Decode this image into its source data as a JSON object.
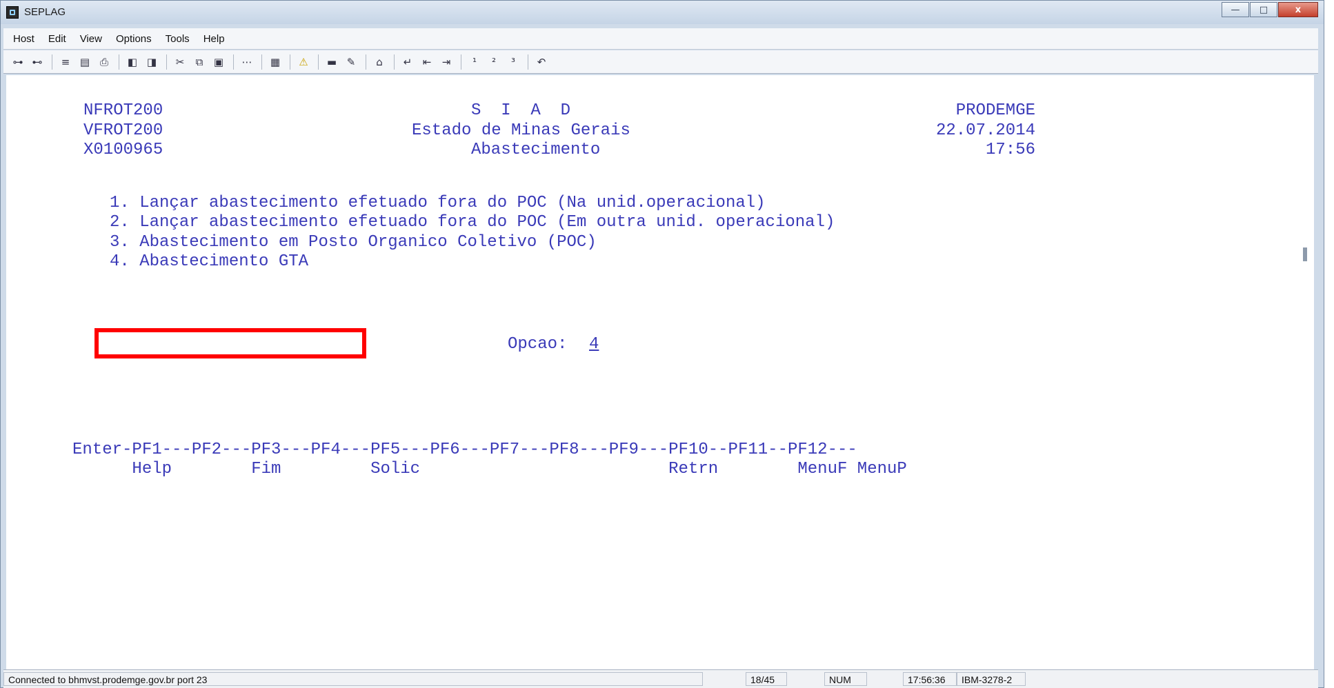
{
  "window": {
    "title": "SEPLAG",
    "buttons": {
      "minimize": "—",
      "maximize": "□",
      "close": "x"
    }
  },
  "menu": [
    "Host",
    "Edit",
    "View",
    "Options",
    "Tools",
    "Help"
  ],
  "toolbar_icons": [
    "connect-icon",
    "disconnect-icon",
    "send-file-icon",
    "receive-file-icon",
    "print-icon",
    "macro-record-icon",
    "macro-play-icon",
    "cut-icon",
    "copy-icon",
    "paste-icon",
    "dots-icon",
    "keyboard-map-icon",
    "warning-icon",
    "screen-icon",
    "pen-icon",
    "home-icon",
    "enter-icon",
    "field-left-icon",
    "tab-icon",
    "pf1-icon",
    "pf2-icon",
    "pf3-icon",
    "undo-icon"
  ],
  "terminal": {
    "header": {
      "left": [
        "NFROT200",
        "VFROT200",
        "X0100965"
      ],
      "center": [
        "S  I  A  D",
        "Estado de Minas Gerais",
        "Abastecimento"
      ],
      "right": [
        "PRODEMGE",
        "22.07.2014",
        "17:56"
      ]
    },
    "options": [
      "1. Lançar abastecimento efetuado fora do POC (Na unid.operacional)",
      "2. Lançar abastecimento efetuado fora do POC (Em outra unid. operacional)",
      "3. Abastecimento em Posto Organico Coletivo (POC)",
      "4. Abastecimento GTA"
    ],
    "prompt_label": "Opcao:",
    "prompt_value": "4",
    "pf_keys_line": "Enter-PF1---PF2---PF3---PF4---PF5---PF6---PF7---PF8---PF9---PF10--PF11--PF12---",
    "pf_labels_line": "      Help        Fim         Solic                         Retrn        MenuF MenuP"
  },
  "status": {
    "connection": "Connected to bhmvst.prodemge.gov.br port 23",
    "cursor": "18/45",
    "num": "NUM",
    "time": "17:56:36",
    "terminal_type": "IBM-3278-2"
  },
  "colors": {
    "terminal_text": "#3a3ab8",
    "highlight_box": "#ff0000",
    "terminal_bg": "#ffffff"
  }
}
